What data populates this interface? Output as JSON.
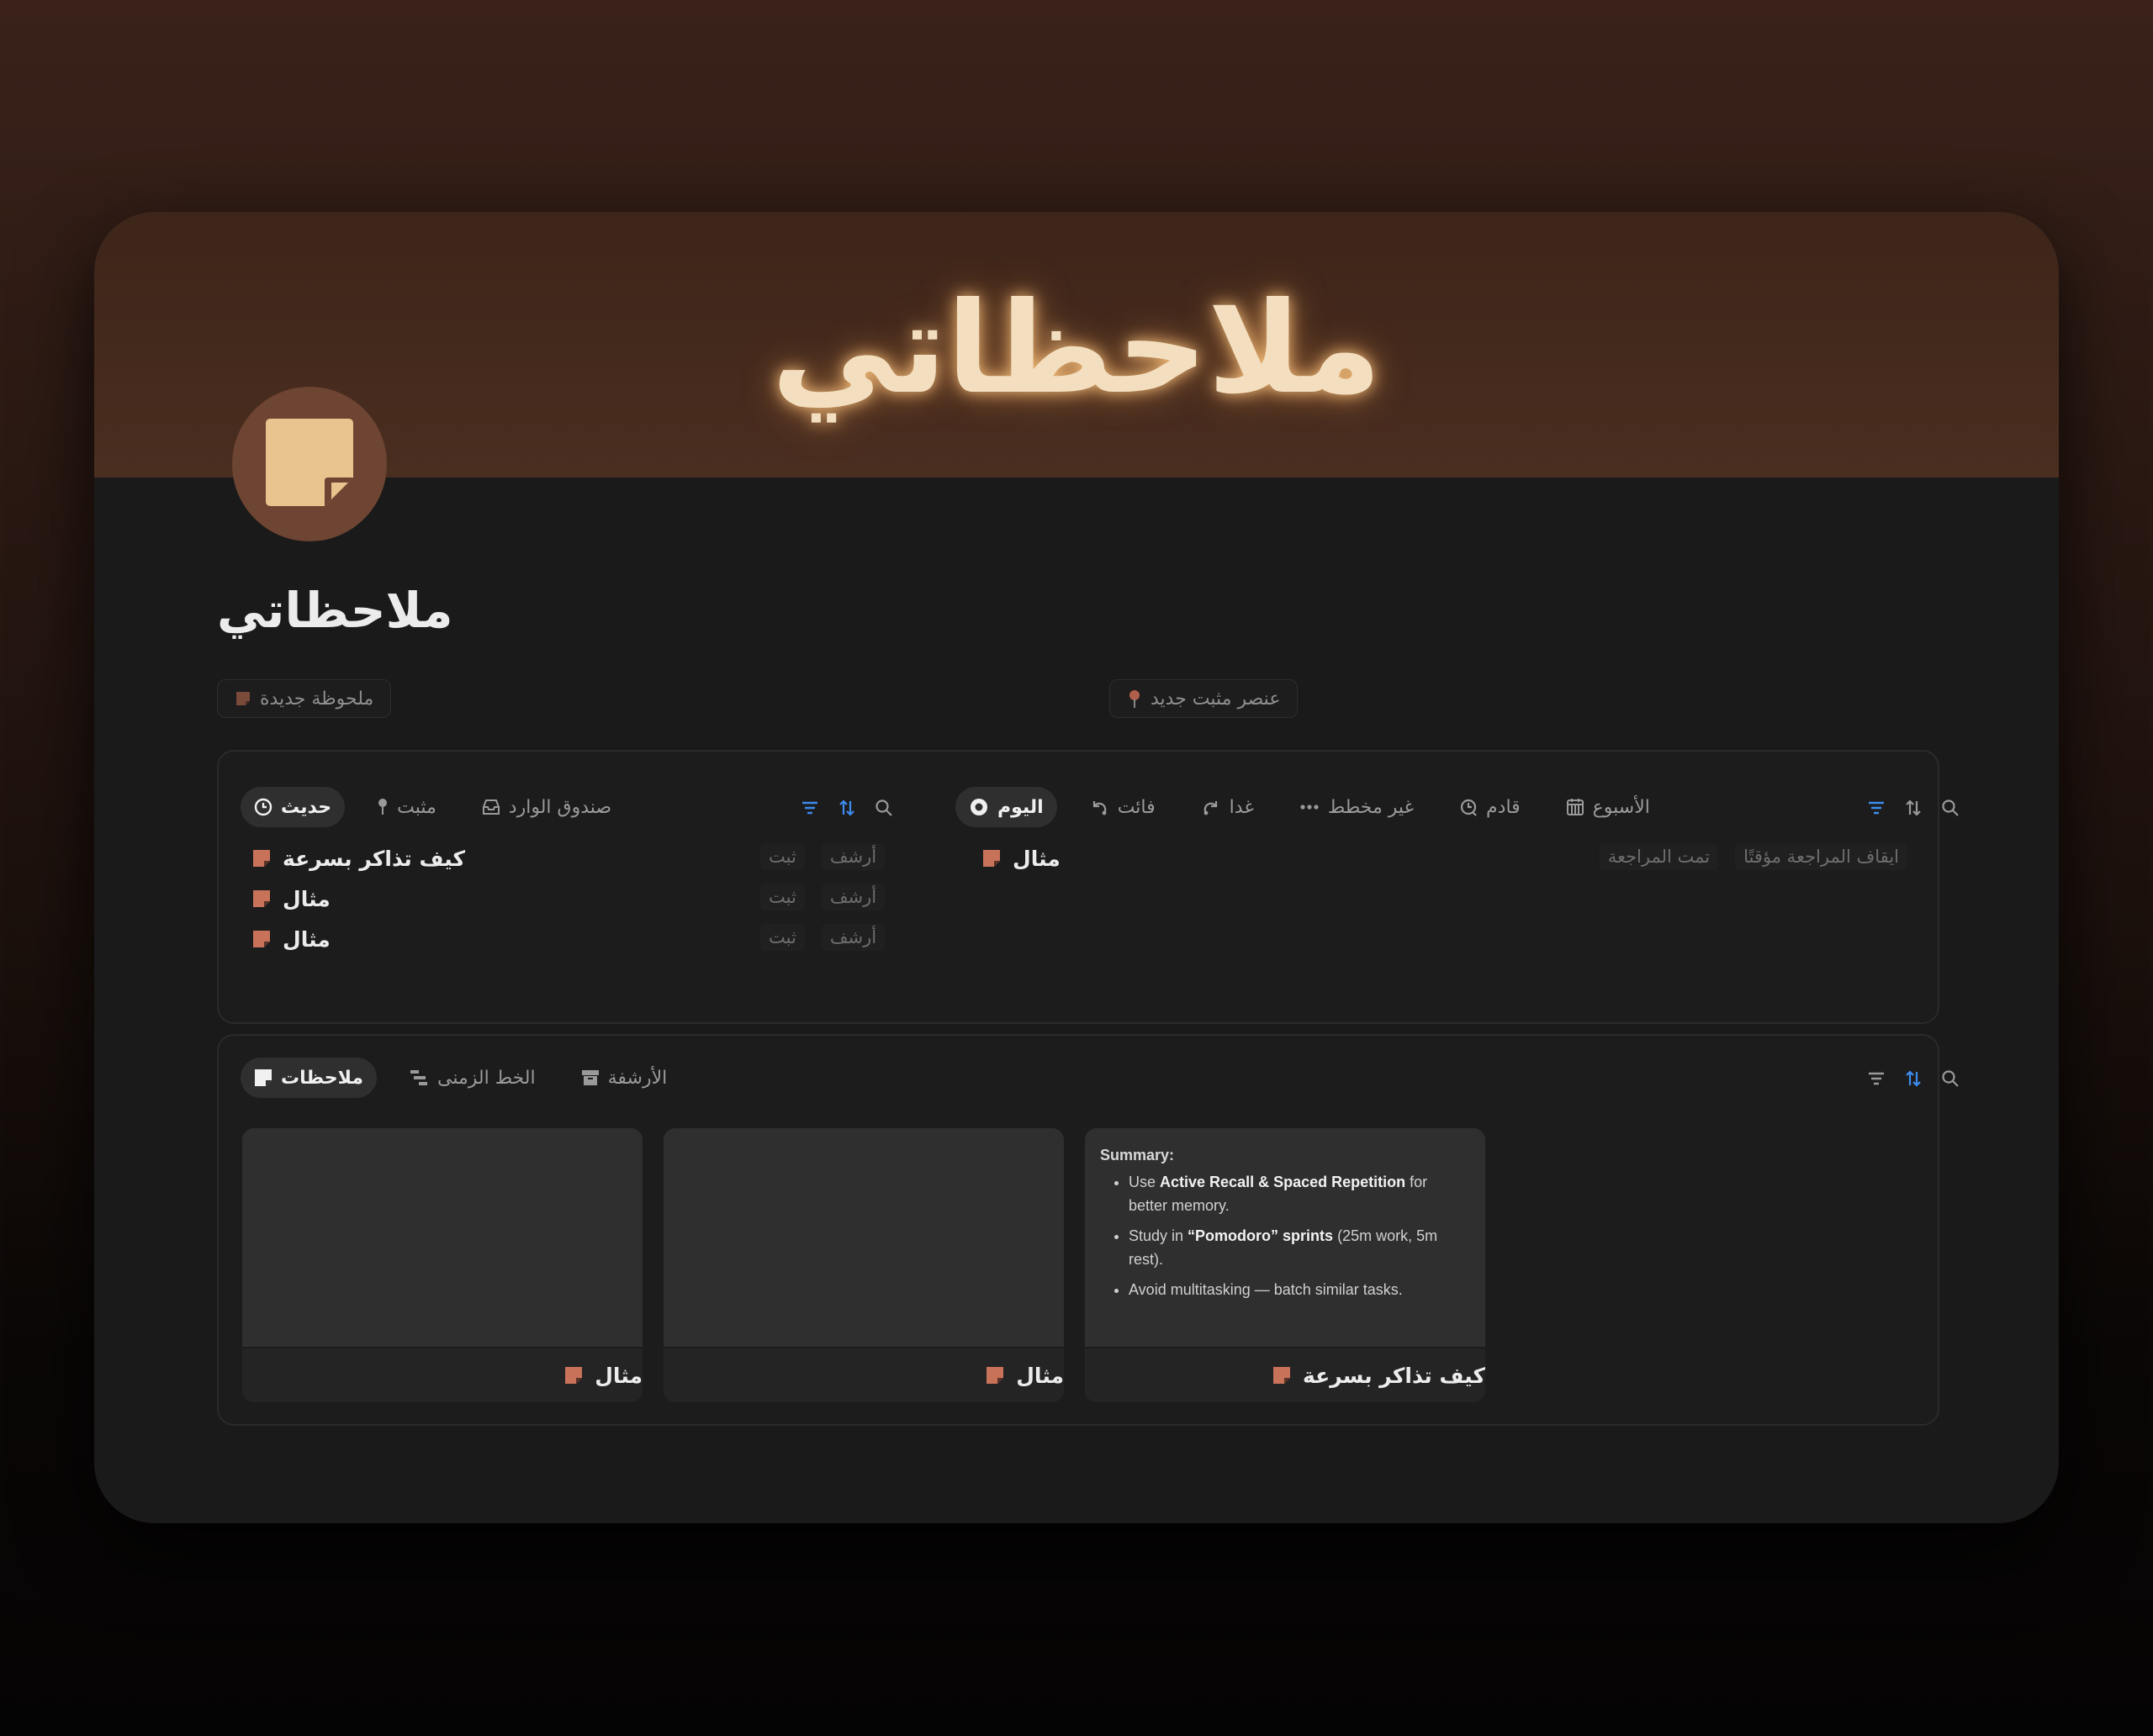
{
  "cover": {
    "title": "ملاحظاتي"
  },
  "page": {
    "title": "ملاحظاتي"
  },
  "buttons": {
    "new_note": "ملحوظة جديدة",
    "new_pinned": "عنصر مثبت جديد"
  },
  "left_panel": {
    "tabs": [
      {
        "label": "حديث",
        "active": true,
        "icon": "clock-icon"
      },
      {
        "label": "مثبت",
        "active": false,
        "icon": "pin-icon"
      },
      {
        "label": "صندوق الوارد",
        "active": false,
        "icon": "inbox-icon"
      }
    ],
    "rows": [
      {
        "title": "كيف تذاكر بسرعة",
        "archive": "أرشف",
        "pin": "ثبت"
      },
      {
        "title": "مثال",
        "archive": "أرشف",
        "pin": "ثبت"
      },
      {
        "title": "مثال",
        "archive": "أرشف",
        "pin": "ثبت"
      }
    ]
  },
  "right_panel": {
    "tabs": [
      {
        "label": "اليوم",
        "active": true,
        "icon": "circle-dot-icon"
      },
      {
        "label": "فائت",
        "active": false,
        "icon": "undo-icon"
      },
      {
        "label": "غدا",
        "active": false,
        "icon": "redo-icon"
      },
      {
        "label": "غير مخطط",
        "active": false,
        "icon": "dots-icon"
      },
      {
        "label": "قادم",
        "active": false,
        "icon": "clock-arrow-icon"
      },
      {
        "label": "الأسبوع",
        "active": false,
        "icon": "calendar-icon"
      }
    ],
    "rows": [
      {
        "title": "مثال",
        "reviewed": "تمت المراجعة",
        "pause": "ايقاف المراجعة مؤقتًا"
      }
    ]
  },
  "bottom_panel": {
    "tabs": [
      {
        "label": "ملاحظات",
        "active": true,
        "icon": "note-icon"
      },
      {
        "label": "الخط الزمنى",
        "active": false,
        "icon": "timeline-icon"
      },
      {
        "label": "الأرشفة",
        "active": false,
        "icon": "archive-icon"
      }
    ],
    "cards": [
      {
        "title": "مثال"
      },
      {
        "title": "مثال"
      },
      {
        "title": "كيف تذاكر بسرعة"
      }
    ],
    "summary": {
      "heading": "Summary:",
      "b1_pre": "Use ",
      "b1_bold1": "Active Recall",
      "b1_mid": " & ",
      "b1_bold2": "Spaced Repetition",
      "b1_post": " for better memory.",
      "b2_pre": "Study in ",
      "b2_bold": "“Pomodoro” sprints",
      "b2_post": " (25m work, 5m rest).",
      "b3": "Avoid multitasking — batch similar tasks."
    }
  },
  "colors": {
    "accent_blue": "#3d8cf0",
    "note_icon": "#c8725a",
    "cover_bg": "#45291d",
    "icon_bg": "#6e4432",
    "icon_fg": "#e9c48f"
  }
}
